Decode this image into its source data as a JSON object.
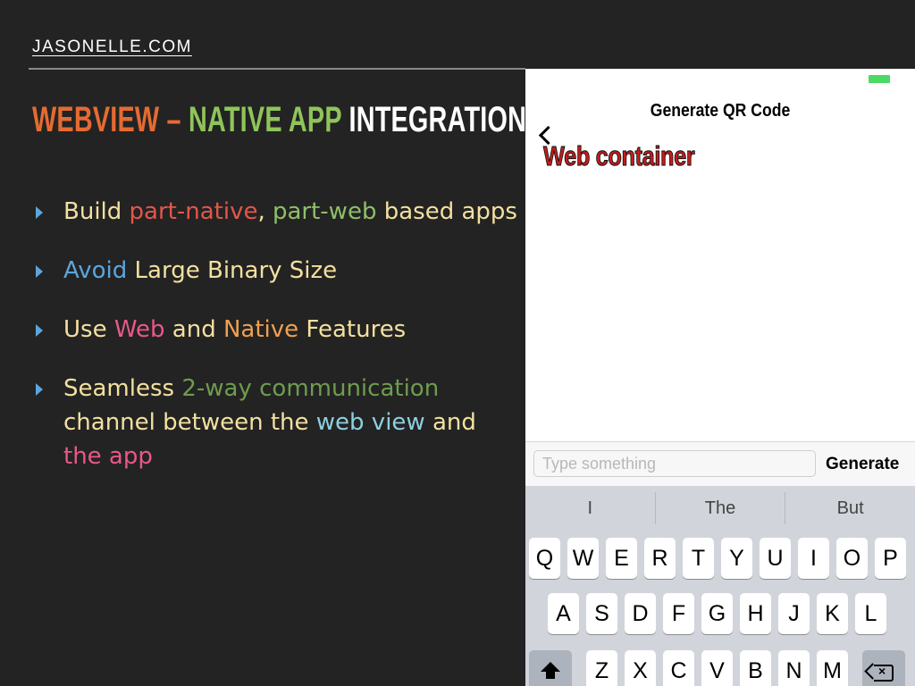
{
  "header": {
    "site_link": "JASONELLE.COM"
  },
  "slide": {
    "title_parts": [
      {
        "text": "WEBVIEW",
        "color": "#e56b32"
      },
      {
        "text": " – ",
        "color": "#e56b32"
      },
      {
        "text": "NATIVE APP",
        "color": "#8fc45a"
      },
      {
        "text": " INTEGRATION",
        "color": "#ffffff"
      }
    ],
    "bullets": [
      {
        "parts": [
          {
            "text": "Build ",
            "color": "#f3e0a0"
          },
          {
            "text": "part-native",
            "color": "#e2574c"
          },
          {
            "text": ", ",
            "color": "#f3e0a0"
          },
          {
            "text": "part-web",
            "color": "#8fbf6a"
          },
          {
            "text": " based apps",
            "color": "#f3e0a0"
          }
        ]
      },
      {
        "parts": [
          {
            "text": "Avoid",
            "color": "#5ca5dc"
          },
          {
            "text": " Large Binary Size",
            "color": "#f3e0a0"
          }
        ]
      },
      {
        "parts": [
          {
            "text": "Use ",
            "color": "#f3e0a0"
          },
          {
            "text": "Web",
            "color": "#e8588b"
          },
          {
            "text": " and ",
            "color": "#f3e0a0"
          },
          {
            "text": "Native",
            "color": "#f0a050"
          },
          {
            "text": " Features",
            "color": "#f3e0a0"
          }
        ]
      },
      {
        "parts": [
          {
            "text": "Seamless ",
            "color": "#f3e0a0"
          },
          {
            "text": "2-way communication",
            "color": "#6e9c4e"
          },
          {
            "text": " channel between the ",
            "color": "#f3e0a0"
          },
          {
            "text": "web view",
            "color": "#8ecfe0"
          },
          {
            "text": " and ",
            "color": "#f3e0a0"
          },
          {
            "text": "the app",
            "color": "#e8588b"
          }
        ]
      }
    ]
  },
  "phone": {
    "nav_title": "Generate QR Code",
    "web_container_label": "Web container",
    "input": {
      "placeholder": "Type something",
      "value": ""
    },
    "generate_label": "Generate",
    "suggestions": [
      "I",
      "The",
      "But"
    ],
    "keyboard": {
      "row1": [
        "Q",
        "W",
        "E",
        "R",
        "T",
        "Y",
        "U",
        "I",
        "O",
        "P"
      ],
      "row2": [
        "A",
        "S",
        "D",
        "F",
        "G",
        "H",
        "J",
        "K",
        "L"
      ],
      "row3": [
        "Z",
        "X",
        "C",
        "V",
        "B",
        "N",
        "M"
      ]
    },
    "icons": {
      "back": "chevron-left-icon",
      "shift": "shift-icon",
      "delete": "backspace-icon"
    },
    "colors": {
      "battery": "#4cd964",
      "web_label": "#c41d1d"
    }
  }
}
